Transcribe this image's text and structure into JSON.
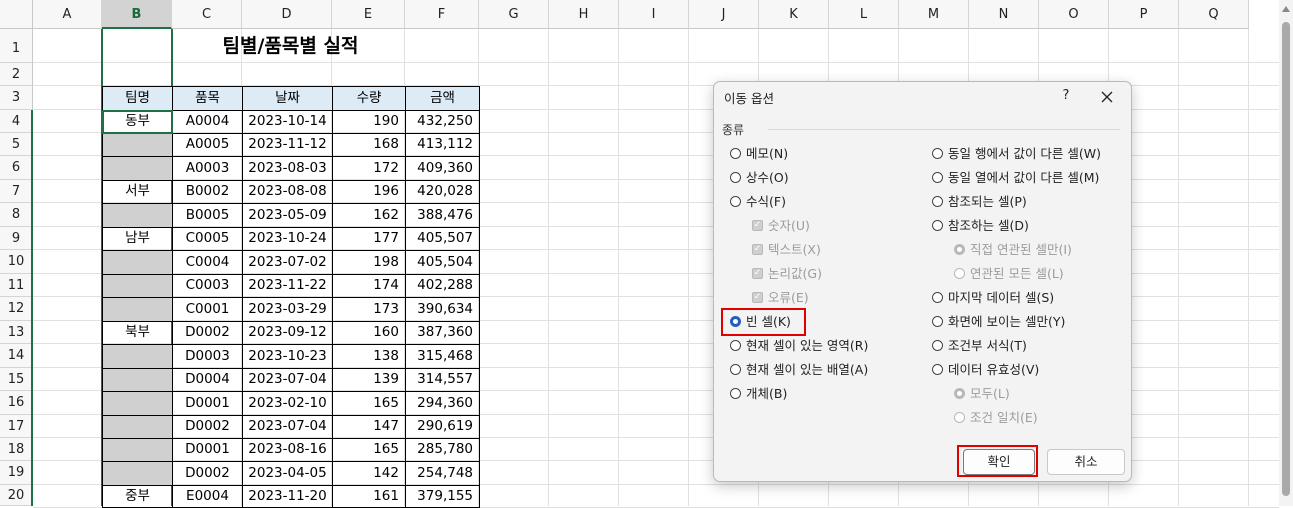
{
  "columns": [
    "A",
    "B",
    "C",
    "D",
    "E",
    "F",
    "G",
    "H",
    "I",
    "J",
    "K",
    "L",
    "M",
    "N",
    "O",
    "P",
    "Q"
  ],
  "selected_column": "B",
  "rows": [
    "1",
    "2",
    "3",
    "4",
    "5",
    "6",
    "7",
    "8",
    "9",
    "10",
    "11",
    "12",
    "13",
    "14",
    "15",
    "16",
    "17",
    "18",
    "19",
    "20"
  ],
  "sheet_title": "팀별/품목별 실적",
  "table_headers": [
    "팀명",
    "품목",
    "날짜",
    "수량",
    "금액"
  ],
  "table_rows": [
    {
      "team": "동부",
      "item": "A0004",
      "date": "2023-10-14",
      "qty": "190",
      "amount": "432,250"
    },
    {
      "team": "",
      "item": "A0005",
      "date": "2023-11-12",
      "qty": "168",
      "amount": "413,112"
    },
    {
      "team": "",
      "item": "A0003",
      "date": "2023-08-03",
      "qty": "172",
      "amount": "409,360"
    },
    {
      "team": "서부",
      "item": "B0002",
      "date": "2023-08-08",
      "qty": "196",
      "amount": "420,028"
    },
    {
      "team": "",
      "item": "B0005",
      "date": "2023-05-09",
      "qty": "162",
      "amount": "388,476"
    },
    {
      "team": "남부",
      "item": "C0005",
      "date": "2023-10-24",
      "qty": "177",
      "amount": "405,507"
    },
    {
      "team": "",
      "item": "C0004",
      "date": "2023-07-02",
      "qty": "198",
      "amount": "405,504"
    },
    {
      "team": "",
      "item": "C0003",
      "date": "2023-11-22",
      "qty": "174",
      "amount": "402,288"
    },
    {
      "team": "",
      "item": "C0001",
      "date": "2023-03-29",
      "qty": "173",
      "amount": "390,634"
    },
    {
      "team": "북부",
      "item": "D0002",
      "date": "2023-09-12",
      "qty": "160",
      "amount": "387,360"
    },
    {
      "team": "",
      "item": "D0003",
      "date": "2023-10-23",
      "qty": "138",
      "amount": "315,468"
    },
    {
      "team": "",
      "item": "D0004",
      "date": "2023-07-04",
      "qty": "139",
      "amount": "314,557"
    },
    {
      "team": "",
      "item": "D0001",
      "date": "2023-02-10",
      "qty": "165",
      "amount": "294,360"
    },
    {
      "team": "",
      "item": "D0002",
      "date": "2023-07-04",
      "qty": "147",
      "amount": "290,619"
    },
    {
      "team": "",
      "item": "D0001",
      "date": "2023-08-16",
      "qty": "165",
      "amount": "285,780"
    },
    {
      "team": "",
      "item": "D0002",
      "date": "2023-04-05",
      "qty": "142",
      "amount": "254,748"
    },
    {
      "team": "중부",
      "item": "E0004",
      "date": "2023-11-20",
      "qty": "161",
      "amount": "379,155"
    }
  ],
  "dialog": {
    "title": "이동 옵션",
    "help": "?",
    "group_label": "종류",
    "left_options": [
      {
        "label": "메모(N)",
        "state": "radio"
      },
      {
        "label": "상수(O)",
        "state": "radio"
      },
      {
        "label": "수식(F)",
        "state": "radio"
      },
      {
        "label": "숫자(U)",
        "state": "check-disabled"
      },
      {
        "label": "텍스트(X)",
        "state": "check-disabled"
      },
      {
        "label": "논리값(G)",
        "state": "check-disabled"
      },
      {
        "label": "오류(E)",
        "state": "check-disabled"
      },
      {
        "label": "빈 셀(K)",
        "state": "radio-checked"
      },
      {
        "label": "현재 셀이 있는 영역(R)",
        "state": "radio"
      },
      {
        "label": "현재 셀이 있는 배열(A)",
        "state": "radio"
      },
      {
        "label": "개체(B)",
        "state": "radio"
      }
    ],
    "right_options": [
      {
        "label": "동일 행에서 값이 다른 셀(W)",
        "state": "radio"
      },
      {
        "label": "동일 열에서 값이 다른 셀(M)",
        "state": "radio"
      },
      {
        "label": "참조되는 셀(P)",
        "state": "radio"
      },
      {
        "label": "참조하는 셀(D)",
        "state": "radio"
      },
      {
        "label": "직접 연관된 셀만(I)",
        "state": "radio-disabled-checked"
      },
      {
        "label": "연관된 모든 셀(L)",
        "state": "radio-disabled"
      },
      {
        "label": "마지막 데이터 셀(S)",
        "state": "radio"
      },
      {
        "label": "화면에 보이는 셀만(Y)",
        "state": "radio"
      },
      {
        "label": "조건부 서식(T)",
        "state": "radio"
      },
      {
        "label": "데이터 유효성(V)",
        "state": "radio"
      },
      {
        "label": "모두(L)",
        "state": "radio-disabled-checked"
      },
      {
        "label": "조건 일치(E)",
        "state": "radio-disabled"
      }
    ],
    "ok_label": "확인",
    "cancel_label": "취소"
  },
  "colors": {
    "header_fill": "#ddebf7",
    "empty_fill": "#d0d0d0",
    "highlight": "#e00000",
    "accent": "#1f5fbf"
  }
}
